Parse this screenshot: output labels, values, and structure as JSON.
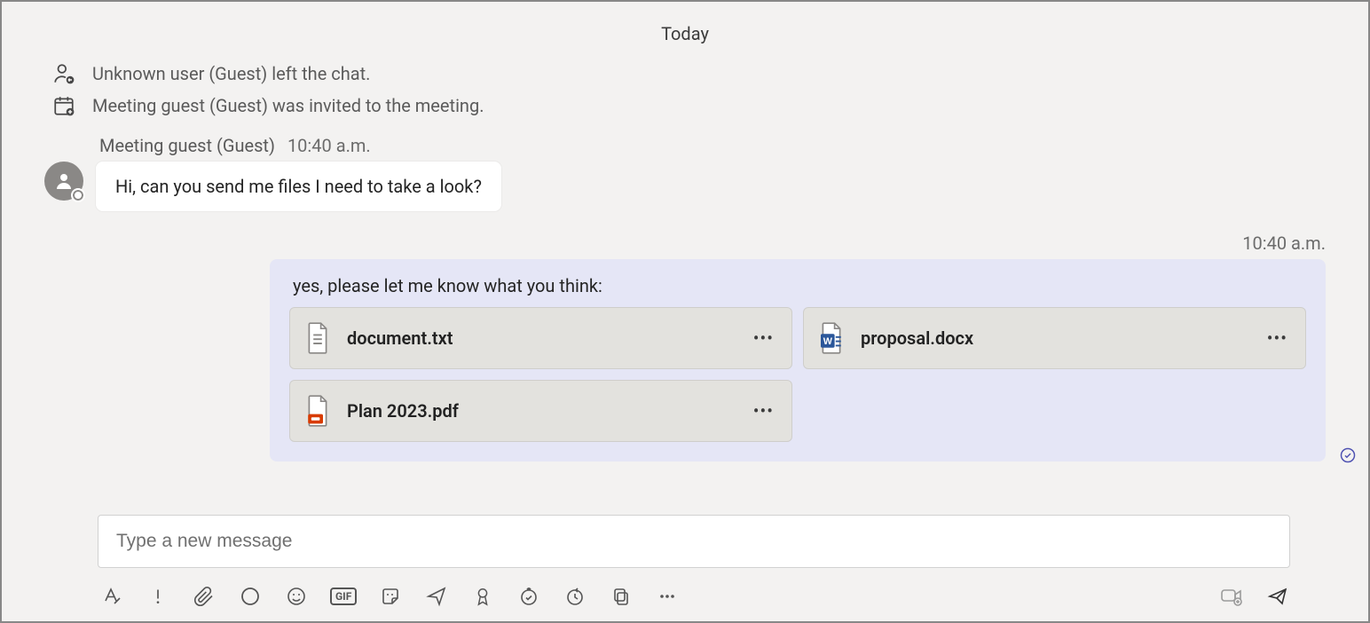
{
  "dateSeparator": "Today",
  "systemEvents": [
    {
      "icon": "person-left",
      "text": "Unknown user (Guest) left the chat."
    },
    {
      "icon": "calendar-add",
      "text": "Meeting guest (Guest) was invited to the meeting."
    }
  ],
  "incoming": {
    "sender": "Meeting guest (Guest)",
    "time": "10:40 a.m.",
    "text": "Hi, can you send me files I need to take a look?"
  },
  "outgoing": {
    "time": "10:40 a.m.",
    "text": "yes, please let me know what you think:",
    "files": [
      {
        "name": "document.txt",
        "type": "txt"
      },
      {
        "name": "proposal.docx",
        "type": "docx"
      },
      {
        "name": "Plan 2023.pdf",
        "type": "pdf"
      }
    ],
    "read": true
  },
  "compose": {
    "placeholder": "Type a new message"
  },
  "toolbar": {
    "gifLabel": "GIF"
  }
}
